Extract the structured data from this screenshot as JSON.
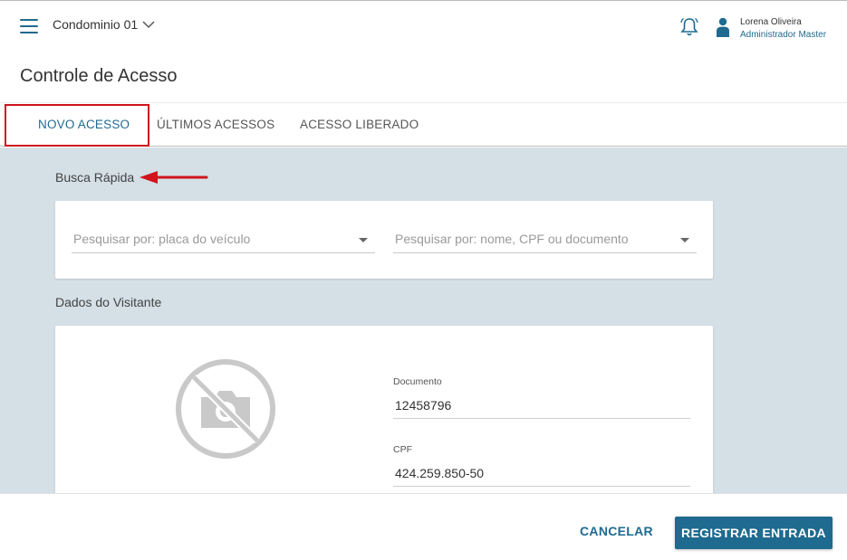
{
  "header": {
    "condominium": "Condominio 01",
    "user_name": "Lorena Oliveira",
    "user_role": "Administrador Master"
  },
  "page_title": "Controle de Acesso",
  "tabs": [
    {
      "label": "NOVO ACESSO",
      "active": true
    },
    {
      "label": "ÚLTIMOS ACESSOS",
      "active": false
    },
    {
      "label": "ACESSO LIBERADO",
      "active": false
    }
  ],
  "quick_search": {
    "label": "Busca Rápida",
    "vehicle_placeholder": "Pesquisar por: placa do veículo",
    "person_placeholder": "Pesquisar por: nome, CPF ou documento"
  },
  "visitor": {
    "label": "Dados do Visitante",
    "photo_icon": "no-camera-icon",
    "fields": [
      {
        "label": "Documento",
        "value": "12458796"
      },
      {
        "label": "CPF",
        "value": "424.259.850-50"
      }
    ]
  },
  "footer": {
    "cancel_label": "CANCELAR",
    "register_label": "REGISTRAR ENTRADA"
  },
  "colors": {
    "accent": "#1f6a8f",
    "highlight": "#d0141b",
    "content_bg": "#d4dfe6"
  }
}
